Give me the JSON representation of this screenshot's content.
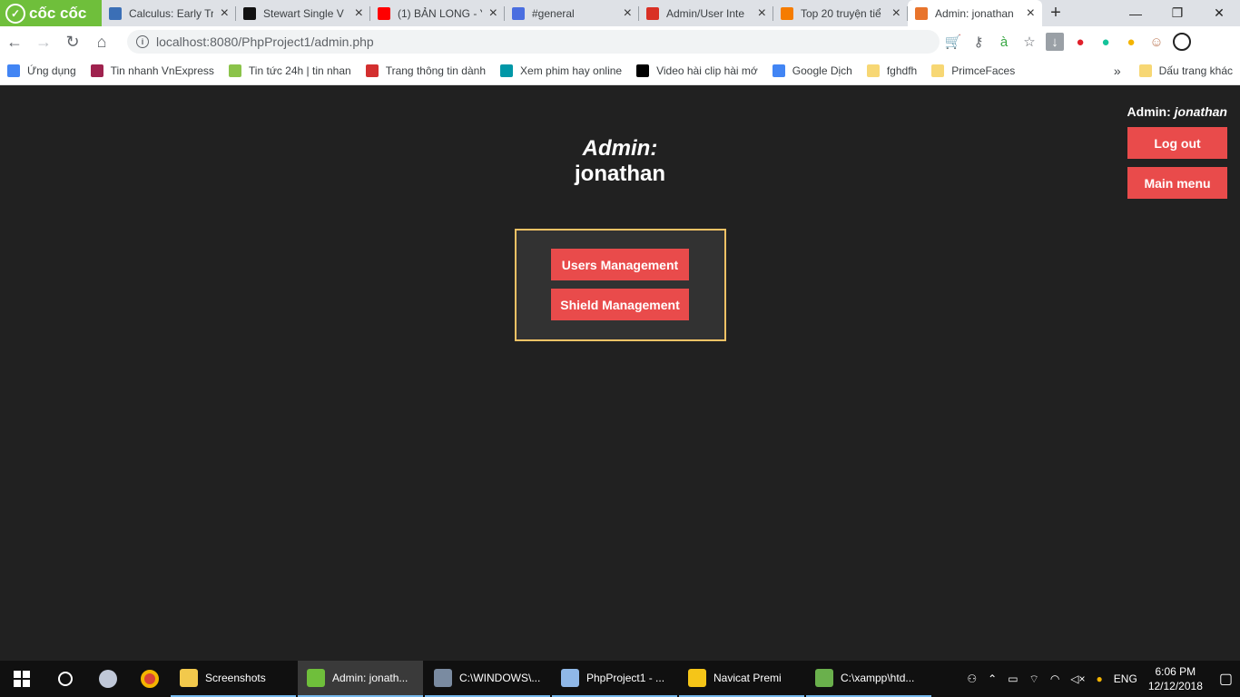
{
  "browser": {
    "brand": "cốc cốc",
    "tabs": [
      {
        "title": "Calculus: Early Tr",
        "color": "#3b6fb6"
      },
      {
        "title": "Stewart Single V",
        "color": "#111111"
      },
      {
        "title": "(1) BẢN LONG - Y",
        "color": "#ff0000"
      },
      {
        "title": "#general",
        "color": "#4a6ee0"
      },
      {
        "title": "Admin/User Inte",
        "color": "#d93025"
      },
      {
        "title": "Top 20 truyện tiể",
        "color": "#f57c00"
      },
      {
        "title": "Admin: jonathan",
        "color": "#e8742c"
      }
    ],
    "url": "localhost:8080/PhpProject1/admin.php",
    "bookmarks": [
      {
        "label": "Ứng dụng",
        "color": "#4285f4"
      },
      {
        "label": "Tin nhanh VnExpress",
        "color": "#9f224e"
      },
      {
        "label": "Tin tức 24h | tin nhan",
        "color": "#8bc34a"
      },
      {
        "label": "Trang thông tin dành",
        "color": "#d32f2f"
      },
      {
        "label": "Xem phim hay online",
        "color": "#0097a7"
      },
      {
        "label": "Video hài clip hài mớ",
        "color": "#000000"
      },
      {
        "label": "Google Dịch",
        "color": "#4285f4"
      },
      {
        "label": "fghdfh",
        "color": "#f7d774"
      },
      {
        "label": "PrimceFaces",
        "color": "#f7d774"
      }
    ],
    "other_bookmarks": "Dấu trang khác",
    "more": "»"
  },
  "page": {
    "title_prefix": "Admin:",
    "title_user": "jonathan",
    "header_label": "Admin:",
    "header_user": "jonathan",
    "logout_label": "Log out",
    "main_menu_label": "Main menu",
    "users_mgmt_label": "Users Management",
    "shield_mgmt_label": "Shield Management",
    "accent_color": "#e94b4b",
    "panel_border_color": "#f4c265"
  },
  "taskbar": {
    "apps": [
      {
        "label": "Screenshots",
        "color": "#f2c94c"
      },
      {
        "label": "Admin: jonath...",
        "color": "#6fbf3b"
      },
      {
        "label": "C:\\WINDOWS\\...",
        "color": "#7a8ba1"
      },
      {
        "label": "PhpProject1 - ...",
        "color": "#8fb8e8"
      },
      {
        "label": "Navicat Premi",
        "color": "#f5c518"
      },
      {
        "label": "C:\\xampp\\htd...",
        "color": "#6ab04c"
      }
    ],
    "language": "ENG",
    "time": "6:06 PM",
    "date": "12/12/2018"
  }
}
